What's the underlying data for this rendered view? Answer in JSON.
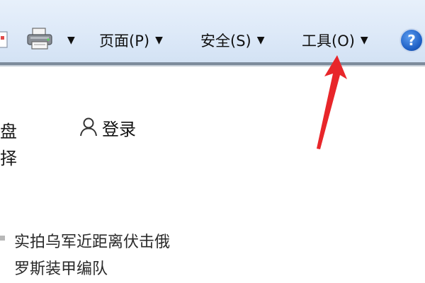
{
  "toolbar": {
    "page_label": "页面(P)",
    "security_label": "安全(S)",
    "tools_label": "工具(O)",
    "dropdown_glyph": "▼",
    "help_glyph": "?",
    "icons": [
      "page-icon",
      "printer-icon",
      "help-icon"
    ]
  },
  "page": {
    "left_fragment_1": "盘",
    "left_fragment_2": "择",
    "login_label": "登录",
    "login_icon": "user-icon",
    "news_line_1": "实拍乌军近距离伏击俄",
    "news_line_2": "罗斯装甲编队"
  },
  "annotation": {
    "arrow_color": "#e8262a"
  },
  "colors": {
    "toolbar_bg": "#dde9f8",
    "help_blue": "#1e5fc4"
  }
}
